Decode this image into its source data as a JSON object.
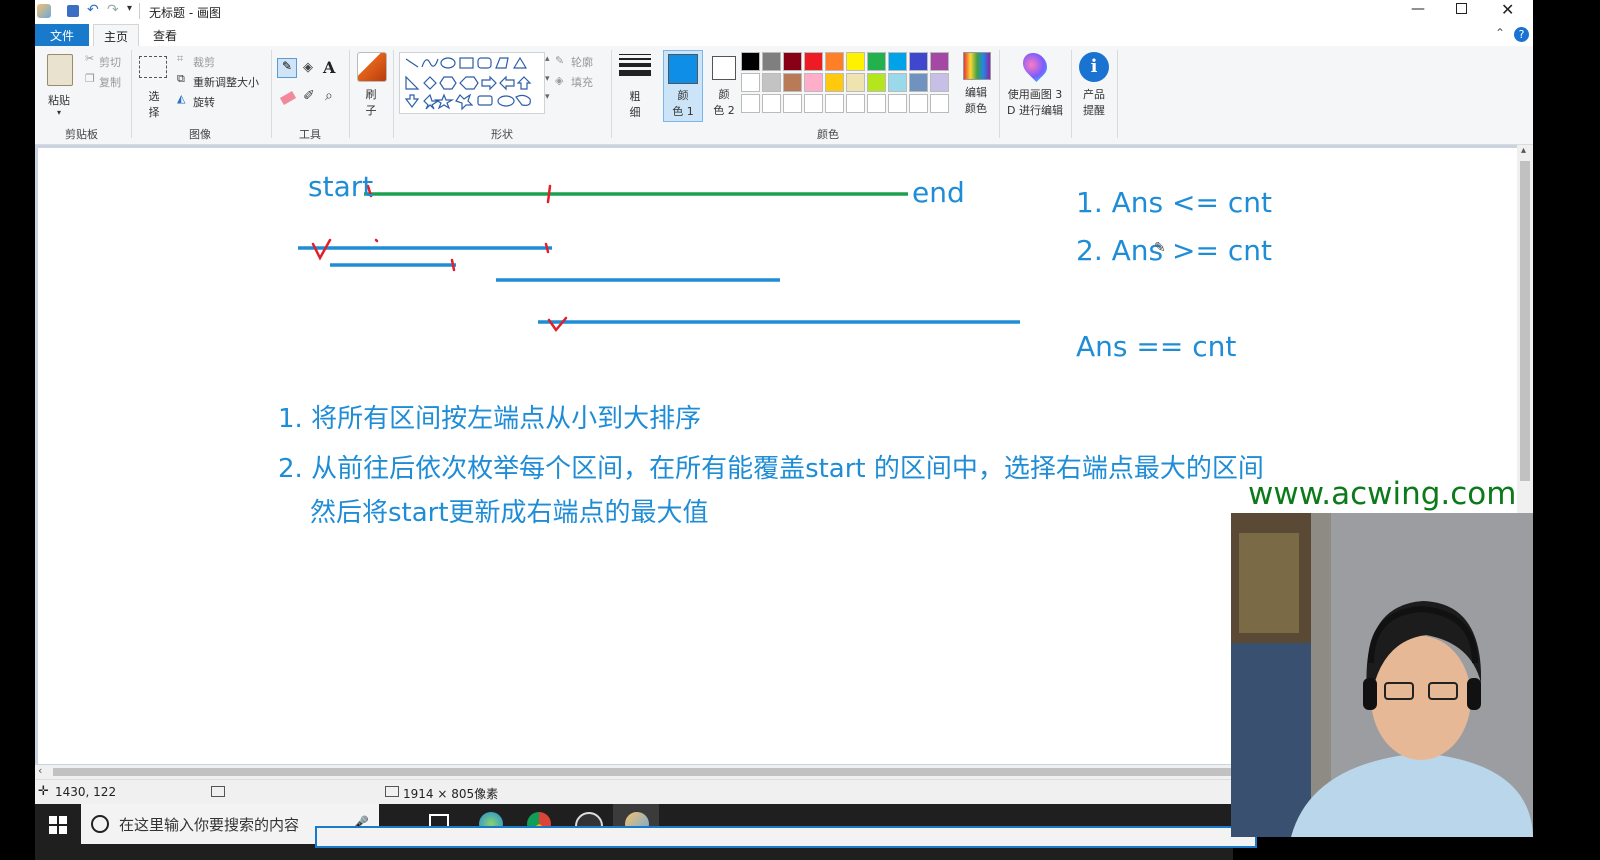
{
  "window": {
    "title": "无标题 - 画图"
  },
  "tabs": {
    "file": "文件",
    "home": "主页",
    "view": "查看"
  },
  "ribbon": {
    "clipboard": {
      "paste": "粘贴",
      "cut": "剪切",
      "copy": "复制",
      "label": "剪贴板"
    },
    "image": {
      "select_top": "选",
      "select_bottom": "择",
      "crop": "裁剪",
      "resize": "重新调整大小",
      "rotate": "旋转",
      "label": "图像"
    },
    "tools": {
      "label": "工具"
    },
    "brushes": {
      "top": "刷",
      "bottom": "子"
    },
    "shapes": {
      "outline": "轮廓",
      "fill": "填充",
      "label": "形状"
    },
    "size": {
      "top": "粗",
      "bottom": "细"
    },
    "color1": {
      "top": "颜",
      "bottom": "色 1"
    },
    "color2": {
      "top": "颜",
      "bottom": "色 2"
    },
    "colors": {
      "label": "颜色"
    },
    "edit_colors": {
      "top": "编辑",
      "bottom": "颜色"
    },
    "paint3d": {
      "top": "使用画图 3",
      "bottom": "D 进行编辑"
    },
    "product_alert": {
      "top": "产品",
      "bottom": "提醒"
    },
    "palette": [
      "#000000",
      "#7f7f7f",
      "#880015",
      "#ed1c24",
      "#ff7f27",
      "#fff200",
      "#22b14c",
      "#00a2e8",
      "#3f48cc",
      "#a349a4",
      "#ffffff",
      "#c3c3c3",
      "#b97a57",
      "#ffaec9",
      "#ffc90e",
      "#efe4b0",
      "#b5e61d",
      "#99d9ea",
      "#7092be",
      "#c8bfe7"
    ],
    "primary_color": "#0f8ee8",
    "secondary_color": "#ffffff"
  },
  "canvas": {
    "start": "start",
    "end": "end",
    "cond1": "1. Ans <= cnt",
    "cond2": "2. Ans >= cnt",
    "cond3": "Ans == cnt",
    "step1": "1. 将所有区间按左端点从小到大排序",
    "step2": "2. 从前往后依次枚举每个区间，在所有能覆盖start 的区间中，选择右端点最大的区间",
    "step2b": "然后将start更新成右端点的最大值",
    "watermark": "www.acwing.com",
    "ink_color": "#1f8dd6",
    "green_line": "#1fa050",
    "red_mark": "#e0202a"
  },
  "statusbar": {
    "cursor_pos": "1430, 122",
    "canvas_size": "1914 × 805像素"
  },
  "taskbar": {
    "search_placeholder": "在这里输入你要搜索的内容"
  }
}
